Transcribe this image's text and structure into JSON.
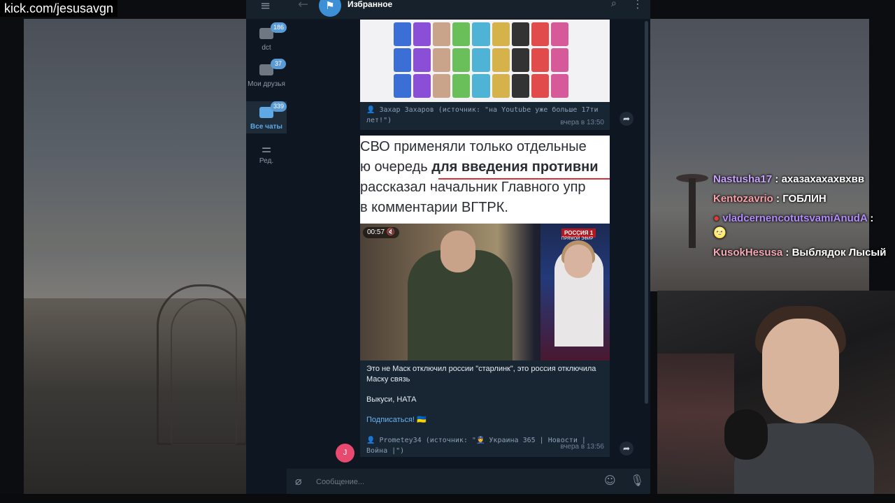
{
  "stream": {
    "url": "kick.com/jesusavgn"
  },
  "chat_overlay": {
    "messages": [
      {
        "user": "Nastusha17",
        "user_color": "#c9a2ff",
        "text": "ахазахахахвхвв"
      },
      {
        "user": "Kentozavrio",
        "user_color": "#ff9fa8",
        "text": "ГОБЛИН"
      },
      {
        "user": "vladcernencotutsvamiAnudA",
        "user_color": "#b38cff",
        "text": "🌝"
      },
      {
        "user": "KusokHesusa",
        "user_color": "#f4a9b8",
        "text": "Выблядок Лысый"
      }
    ]
  },
  "telegram": {
    "header": {
      "title": "Избранное",
      "menu_icon": "hamburger-icon",
      "back_icon": "back-arrow-icon",
      "search_icon": "search-icon",
      "more_icon": "more-vert-icon"
    },
    "folders": [
      {
        "label": "dct",
        "badge": "186",
        "active": false
      },
      {
        "label": "Мои друзья",
        "badge": "37",
        "active": false
      },
      {
        "label": "Все чаты",
        "badge": "339",
        "active": true
      },
      {
        "label": "Ред.",
        "badge": "",
        "active": false
      }
    ],
    "messages": [
      {
        "source": "👤 Захар Захаров (источник: \"на Youtube уже больше 17ти лет!\")",
        "time": "вчера в 13:50"
      },
      {
        "image_text_lines": [
          "СВО применяли только отдельные",
          "ю очередь для введения противни",
          "рассказал начальник Главного упр",
          "в комментарии ВГТРК."
        ],
        "image_bold_fragment": "для введения противни",
        "video": {
          "duration": "00:57",
          "channel": "РОССИЯ 1",
          "channel_sub": "ПРЯМОЙ ЭФИР"
        },
        "text_title": "Это не Маск отключил россии \"старлинк\", это россия отключила Маску связь",
        "text_body": "Выкуси, НАТА",
        "subscribe_link": "Подписаться! 🇺🇦",
        "source": "👤 Prometey34 (источник: \"👮 Украина 365 | Новости | Война |\")",
        "time": "вчера в 13:56",
        "avatar_letter": "J"
      }
    ],
    "composer": {
      "placeholder": "Сообщение..."
    },
    "accent": "#5ea8e6"
  }
}
